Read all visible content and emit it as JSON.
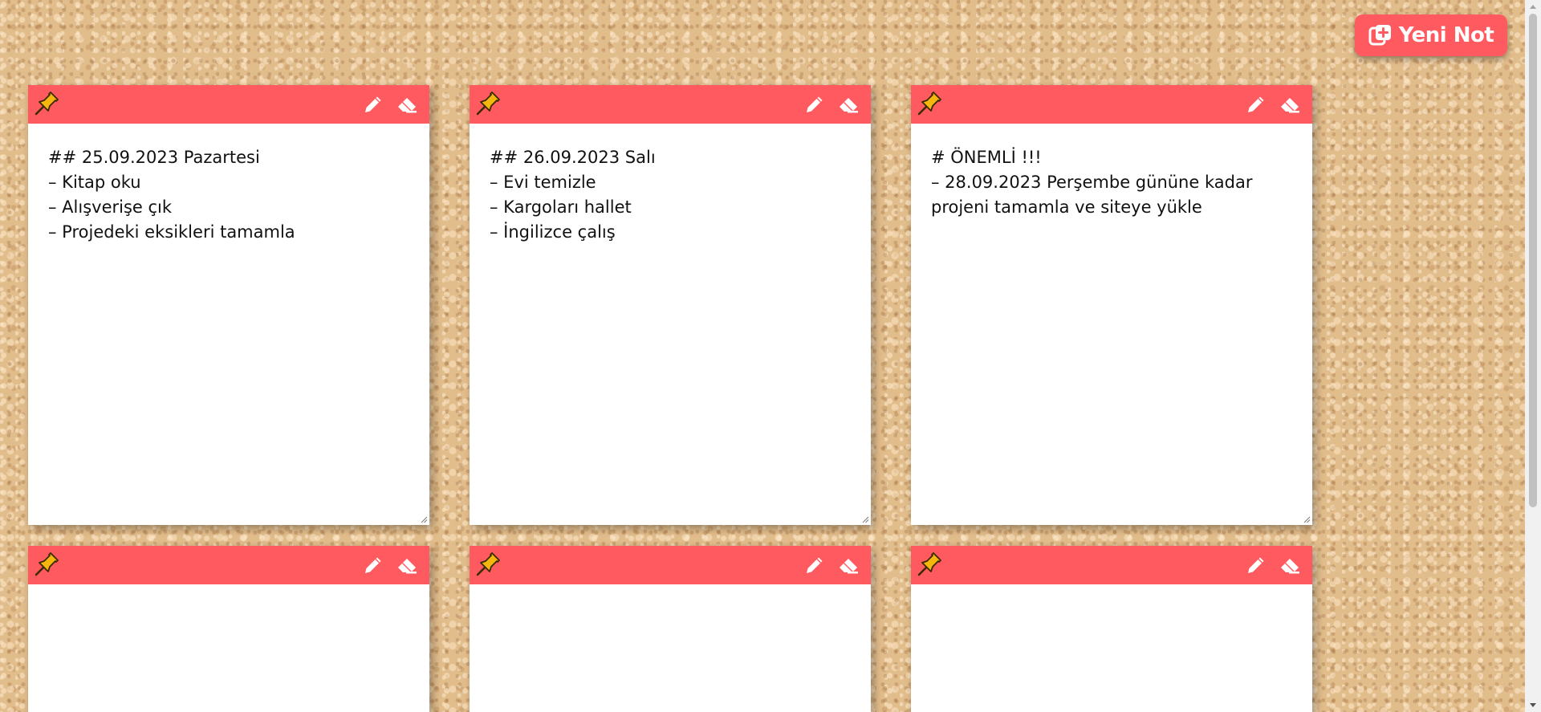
{
  "toolbar": {
    "new_note_label": "Yeni Not"
  },
  "colors": {
    "accent": "#ff5a5f",
    "pin": "#f5b70d",
    "board": "#e2bd8c"
  },
  "icons": {
    "new_note": "square-plus-icon",
    "pin": "pushpin-icon",
    "edit": "pencil-icon",
    "erase": "eraser-icon"
  },
  "notes": [
    {
      "content": "## 25.09.2023 Pazartesi\n– Kitap oku\n– Alışverişe çık\n– Projedeki eksikleri tamamla"
    },
    {
      "content": "## 26.09.2023 Salı\n– Evi temizle\n– Kargoları hallet\n– İngilizce çalış"
    },
    {
      "content": "# ÖNEMLİ !!!\n– 28.09.2023 Perşembe gününe kadar projeni tamamla ve siteye yükle"
    },
    {
      "content": ""
    },
    {
      "content": ""
    },
    {
      "content": ""
    }
  ]
}
